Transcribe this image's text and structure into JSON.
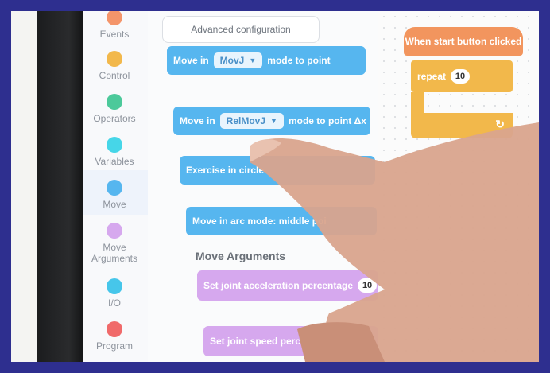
{
  "categories": [
    {
      "label": "Events",
      "color": "#f4956a"
    },
    {
      "label": "Control",
      "color": "#f2b84b"
    },
    {
      "label": "Operators",
      "color": "#4cc99a"
    },
    {
      "label": "Variables",
      "color": "#46d6e8"
    },
    {
      "label": "Move",
      "color": "#56b6ef"
    },
    {
      "label": "Move Arguments",
      "color": "#d6a8ee"
    },
    {
      "label": "I/O",
      "color": "#46c6ea"
    },
    {
      "label": "Program",
      "color": "#f06a6a"
    }
  ],
  "palette": {
    "advanced_label": "Advanced configuration",
    "move_blocks": [
      {
        "prefix": "Move in",
        "chip": "MovJ",
        "suffix": "mode to point"
      },
      {
        "prefix": "Move in",
        "chip": "RelMovJ",
        "suffix": "mode to point Δx"
      },
      {
        "text": "Exercise in circle"
      },
      {
        "text": "Move in arc mode: middle poi"
      }
    ],
    "move_args_title": "Move Arguments",
    "arg_blocks": [
      {
        "text": "Set joint acceleration percentage",
        "value": "10",
        "unit": "%"
      },
      {
        "text": "Set joint speed percent"
      }
    ]
  },
  "canvas": {
    "hat_label": "When start button clicked",
    "repeat_label": "repeat",
    "repeat_value": "10"
  }
}
